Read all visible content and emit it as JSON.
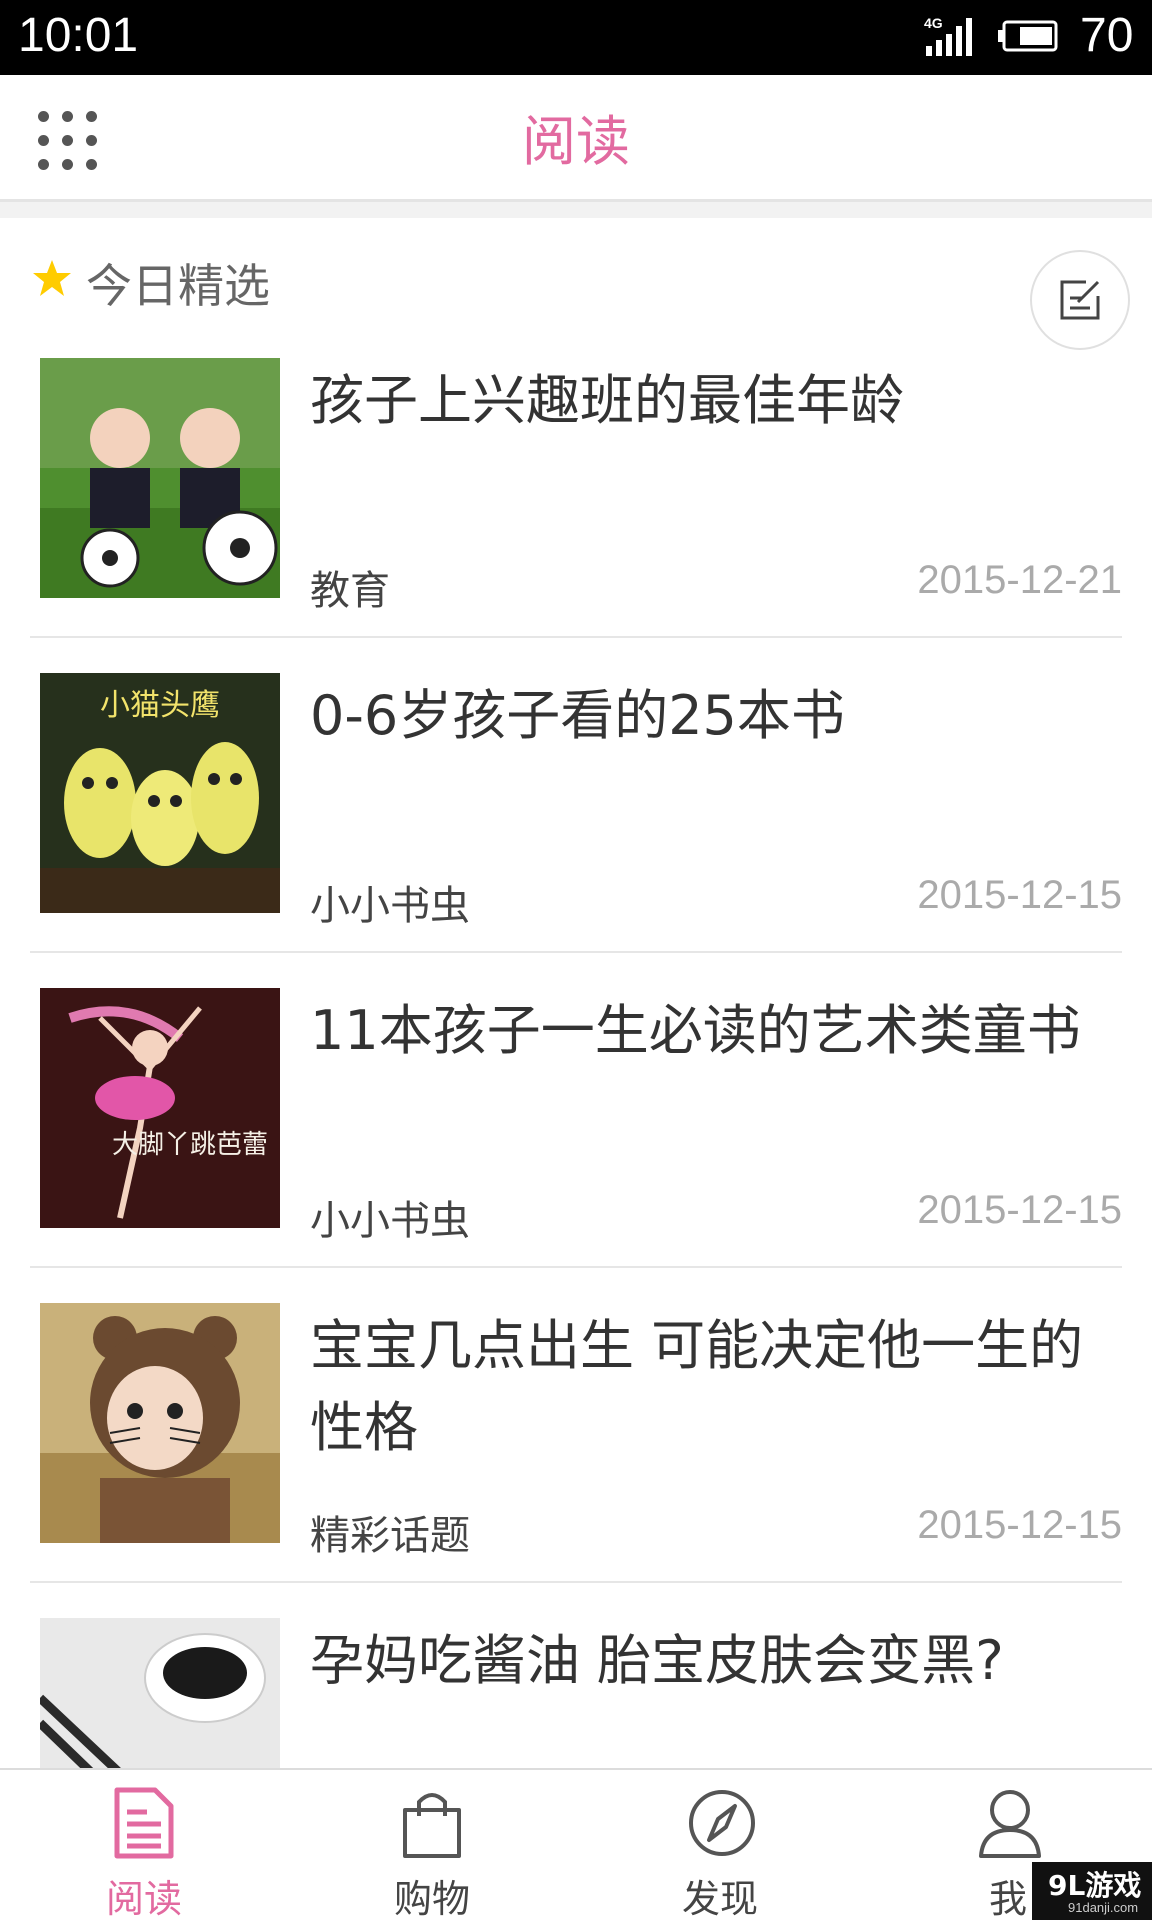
{
  "status_bar": {
    "time": "10:01",
    "network": "4G",
    "battery": "70"
  },
  "header": {
    "title": "阅读",
    "menu_icon": "grid-menu-icon"
  },
  "section": {
    "label": "今日精选",
    "star_color": "#ffcc00",
    "edit_icon": "edit-icon"
  },
  "articles": [
    {
      "title": "孩子上兴趣班的最佳年龄",
      "category": "教育",
      "date": "2015-12-21"
    },
    {
      "title": "0-6岁孩子看的25本书",
      "category": "小小书虫",
      "date": "2015-12-15",
      "cover_text": "小猫头鹰"
    },
    {
      "title": "11本孩子一生必读的艺术类童书",
      "category": "小小书虫",
      "date": "2015-12-15",
      "cover_text": "大脚丫跳芭蕾"
    },
    {
      "title": "宝宝几点出生 可能决定他一生的性格",
      "category": "精彩话题",
      "date": "2015-12-15"
    },
    {
      "title": "孕妈吃酱油 胎宝皮肤会变黑?",
      "category": "",
      "date": ""
    }
  ],
  "tabs": [
    {
      "label": "阅读",
      "icon": "document-icon",
      "active": true
    },
    {
      "label": "购物",
      "icon": "shopping-bag-icon",
      "active": false
    },
    {
      "label": "发现",
      "icon": "compass-icon",
      "active": false
    },
    {
      "label": "我",
      "icon": "user-icon",
      "active": false
    }
  ],
  "watermark": {
    "brand": "9L游戏",
    "url": "91danji.com"
  },
  "colors": {
    "accent": "#e26aa0",
    "muted_text": "#aaaaaa"
  }
}
